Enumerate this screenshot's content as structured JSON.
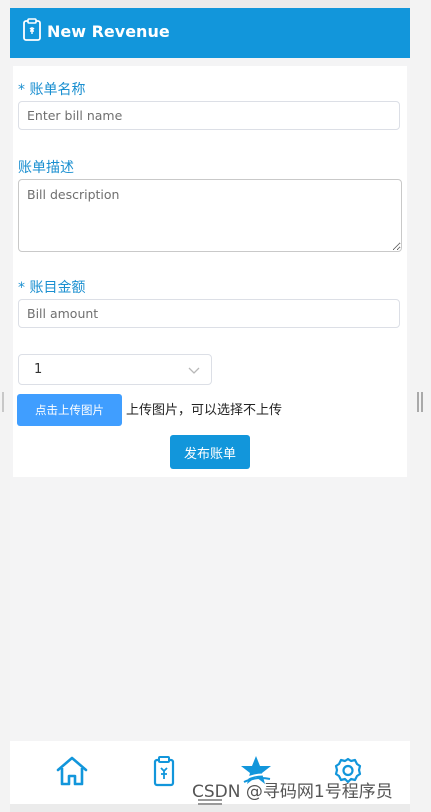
{
  "header": {
    "title": "New Revenue",
    "icon": "clipboard-icon",
    "color": "#1296db"
  },
  "form": {
    "name_label": "账单名称",
    "name_required": "*",
    "name_placeholder": "Enter bill name",
    "desc_label": "账单描述",
    "desc_placeholder": "Bill description",
    "amount_label": "账目金额",
    "amount_required": "*",
    "amount_placeholder": "Bill amount",
    "select_value": "1",
    "upload_button": "点击上传图片",
    "upload_tip": "上传图片，可以选择不上传",
    "publish_button": "发布账单"
  },
  "tabbar": {
    "items": [
      {
        "icon": "home-icon"
      },
      {
        "icon": "clipboard-icon"
      },
      {
        "icon": "star-icon"
      },
      {
        "icon": "settings-icon"
      }
    ]
  },
  "watermark": "CSDN @寻码网1号程序员",
  "colors": {
    "accent": "#1296db",
    "upload": "#409eff",
    "label": "#1a8fd0"
  }
}
